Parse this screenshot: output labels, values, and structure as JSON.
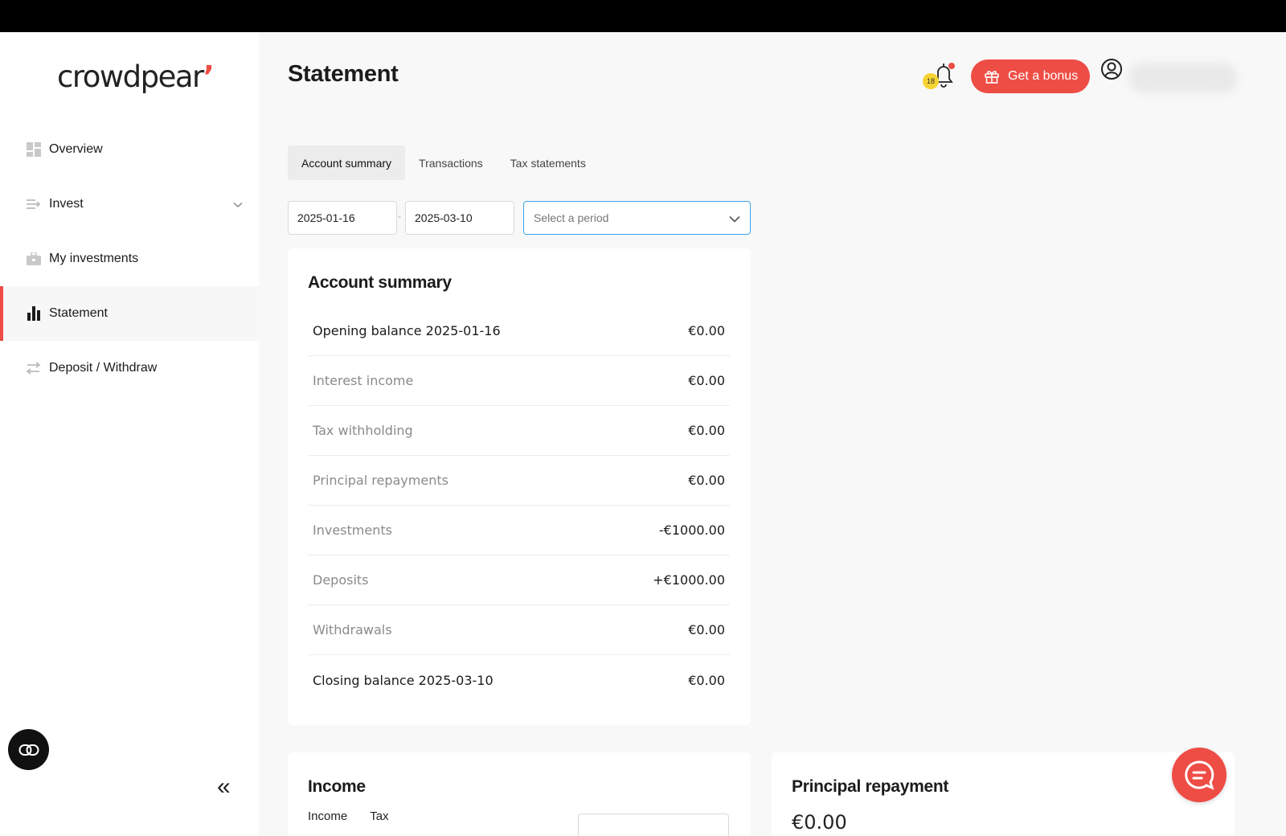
{
  "brand": {
    "logo_text": "crowdpear",
    "accent_color": "#ee4d45"
  },
  "sidebar": {
    "items": [
      {
        "label": "Overview",
        "icon": "dashboard-icon"
      },
      {
        "label": "Invest",
        "icon": "invest-arrows-icon",
        "has_chevron": true
      },
      {
        "label": "My investments",
        "icon": "briefcase-icon"
      },
      {
        "label": "Statement",
        "icon": "bar-chart-icon",
        "active": true
      },
      {
        "label": "Deposit / Withdraw",
        "icon": "transfer-icon"
      }
    ],
    "collapse_label": "«"
  },
  "header": {
    "title": "Statement",
    "notifications_count": "18",
    "bonus_label": "Get a bonus"
  },
  "tabs": [
    {
      "label": "Account summary",
      "active": true
    },
    {
      "label": "Transactions"
    },
    {
      "label": "Tax statements"
    }
  ],
  "filters": {
    "date_from": "2025-01-16",
    "date_separator": "-",
    "date_to": "2025-03-10",
    "period_placeholder": "Select a period"
  },
  "summary": {
    "title": "Account summary",
    "rows": [
      {
        "label": "Opening balance 2025-01-16",
        "value": "€0.00"
      },
      {
        "label": "Interest income",
        "value": "€0.00"
      },
      {
        "label": "Tax withholding",
        "value": "€0.00"
      },
      {
        "label": "Principal repayments",
        "value": "€0.00"
      },
      {
        "label": "Investments",
        "value": "-€1000.00"
      },
      {
        "label": "Deposits",
        "value": "+€1000.00"
      },
      {
        "label": "Withdrawals",
        "value": "€0.00"
      },
      {
        "label": "Closing balance 2025-03-10",
        "value": "€0.00"
      }
    ]
  },
  "income": {
    "title": "Income",
    "tabs": [
      "Income",
      "Tax"
    ]
  },
  "principal": {
    "title": "Principal repayment",
    "value": "€0.00"
  }
}
